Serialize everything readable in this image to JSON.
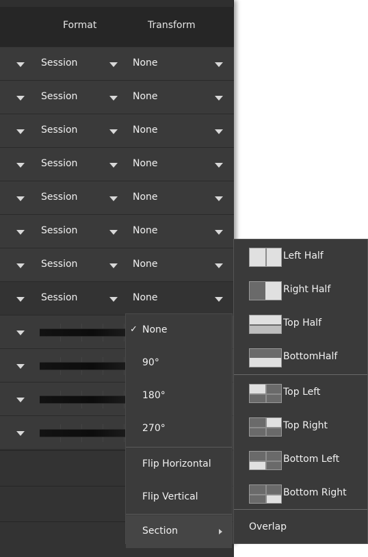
{
  "header": {
    "format_label": "Format",
    "transform_label": "Transform"
  },
  "rows": [
    {
      "format": "Session",
      "transform": "None"
    },
    {
      "format": "Session",
      "transform": "None"
    },
    {
      "format": "Session",
      "transform": "None"
    },
    {
      "format": "Session",
      "transform": "None"
    },
    {
      "format": "Session",
      "transform": "None"
    },
    {
      "format": "Session",
      "transform": "None"
    },
    {
      "format": "Session",
      "transform": "None"
    },
    {
      "format": "Session",
      "transform": "None"
    }
  ],
  "transform_menu": {
    "items": [
      {
        "label": "None",
        "checked": true,
        "check_mark": "✓"
      },
      {
        "label": "90°"
      },
      {
        "label": "180°"
      },
      {
        "label": "270°"
      },
      {
        "label": "Flip Horizontal"
      },
      {
        "label": "Flip Vertical"
      },
      {
        "label": "Section",
        "has_submenu": true
      }
    ]
  },
  "section_submenu": {
    "items": [
      {
        "label": "Left Half",
        "icon": "left-half-icon"
      },
      {
        "label": "Right Half",
        "icon": "right-half-icon"
      },
      {
        "label": "Top Half",
        "icon": "top-half-icon"
      },
      {
        "label": "BottomHalf",
        "icon": "bottom-half-icon"
      },
      {
        "label": "Top Left",
        "icon": "top-left-quadrant-icon"
      },
      {
        "label": "Top Right",
        "icon": "top-right-quadrant-icon"
      },
      {
        "label": "Bottom Left",
        "icon": "bottom-left-quadrant-icon"
      },
      {
        "label": "Bottom Right",
        "icon": "bottom-right-quadrant-icon"
      },
      {
        "label": "Overlap"
      }
    ]
  },
  "colors": {
    "panel": "#2f2f2f",
    "row": "#3a3a3a",
    "menu": "#3b3b3b",
    "text": "#f0f0f0"
  }
}
